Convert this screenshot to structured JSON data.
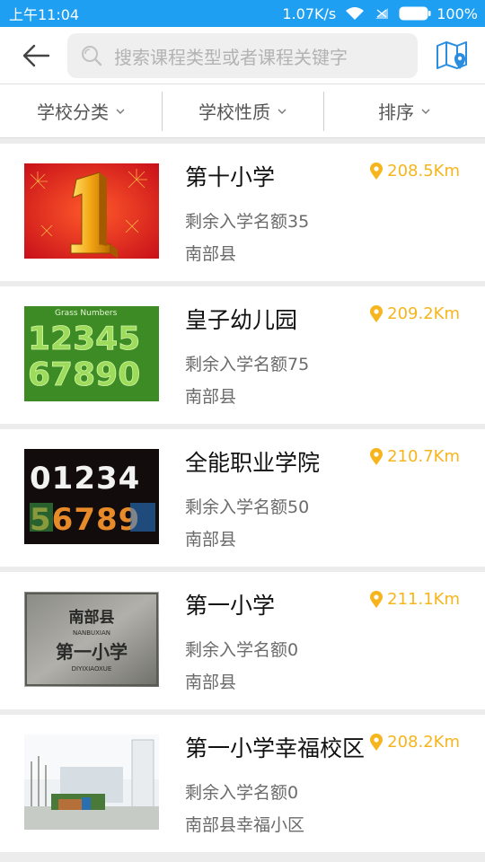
{
  "status_bar": {
    "time": "上午11:04",
    "speed": "1.07K/s",
    "battery": "100%"
  },
  "search": {
    "placeholder": "搜索课程类型或者课程关键字"
  },
  "filters": [
    {
      "label": "学校分类"
    },
    {
      "label": "学校性质"
    },
    {
      "label": "排序"
    }
  ],
  "schools": [
    {
      "name": "第十小学",
      "quota": "剩余入学名额35",
      "area": "南部县",
      "distance": "208.5Km",
      "thumb": "fireworks-number-one"
    },
    {
      "name": "皇子幼儿园",
      "quota": "剩余入学名额75",
      "area": "南部县",
      "distance": "209.2Km",
      "thumb": "grass-numbers",
      "thumb_text": "Grass Numbers",
      "thumb_digits_1": "12345",
      "thumb_digits_2": "67890"
    },
    {
      "name": "全能职业学院",
      "quota": "剩余入学名额50",
      "area": "南部县",
      "distance": "210.7Km",
      "thumb": "colorful-digits",
      "thumb_digits_1": "01234",
      "thumb_digits_2": "56789"
    },
    {
      "name": "第一小学",
      "quota": "剩余入学名额0",
      "area": "南部县",
      "distance": "211.1Km",
      "thumb": "stone-plaque",
      "plaque_line1": "南部县",
      "plaque_line2": "NANBUXIAN",
      "plaque_line3": "第一小学",
      "plaque_line4": "DIYIXIAOXUE"
    },
    {
      "name": "第一小学幸福校区",
      "quota": "剩余入学名额0",
      "area": "南部县幸福小区",
      "distance": "208.2Km",
      "thumb": "campus-photo"
    }
  ],
  "colors": {
    "status_blue": "#1e9ff1",
    "accent_blue": "#2a8de0",
    "distance_yellow": "#f6b51d"
  }
}
